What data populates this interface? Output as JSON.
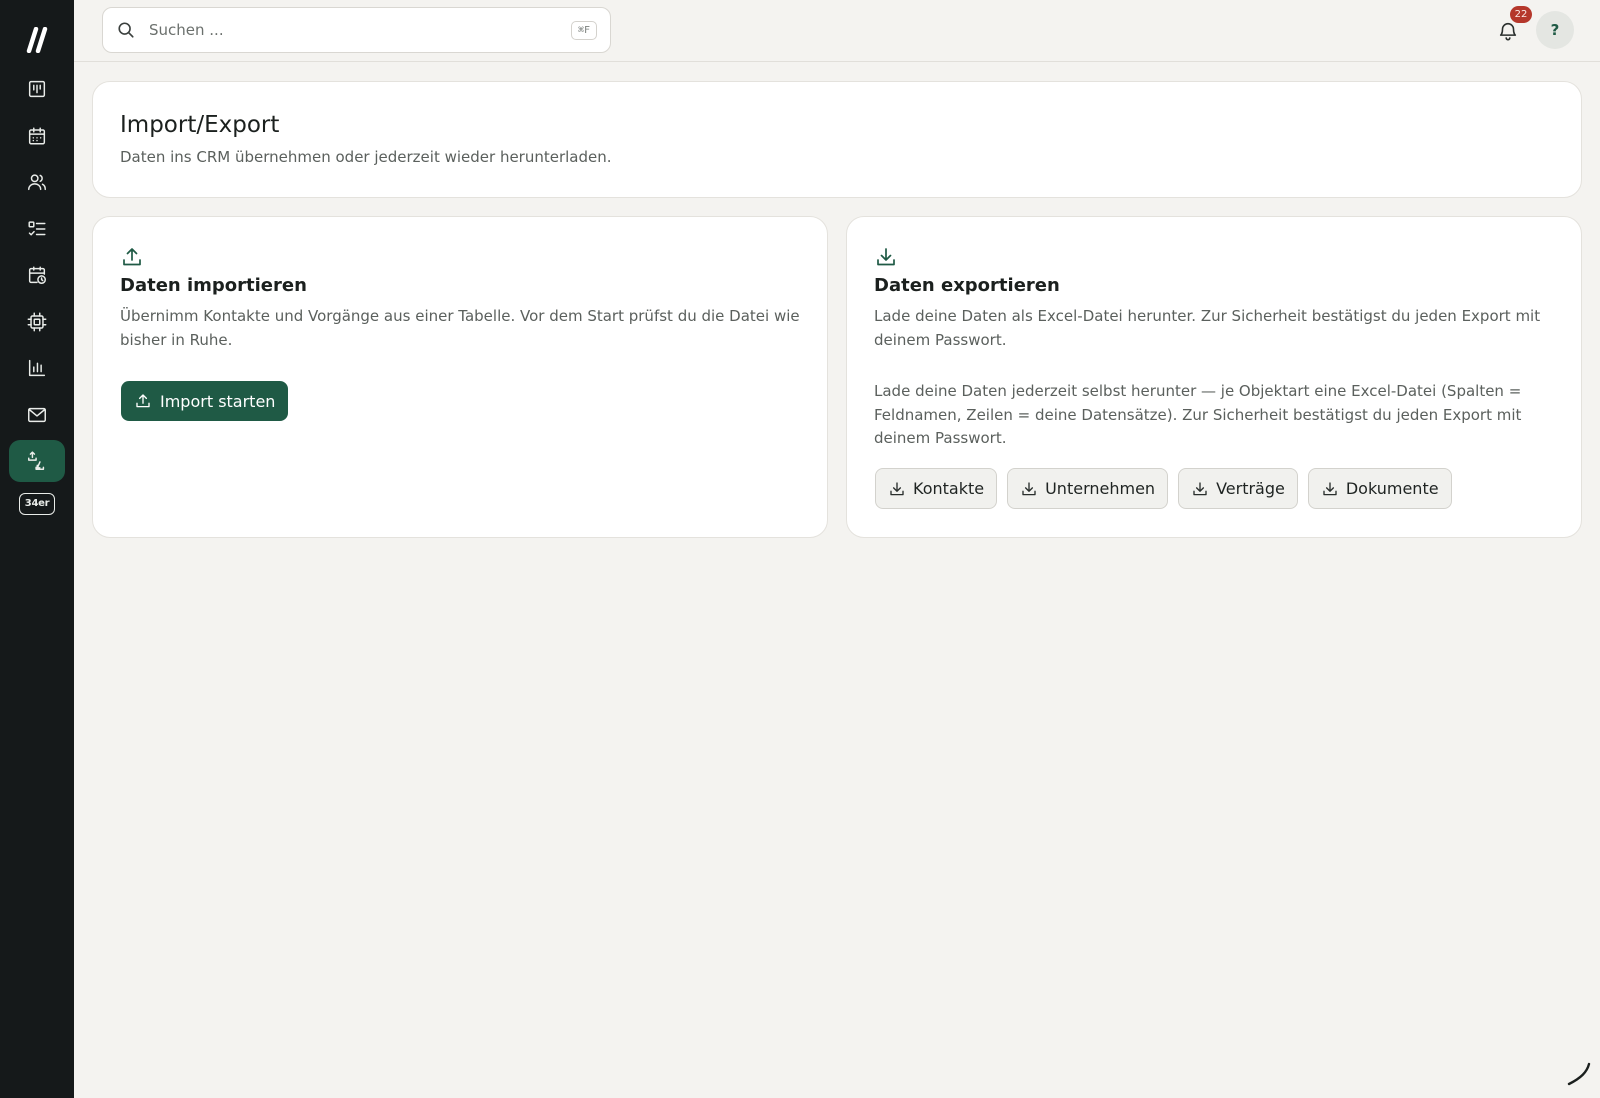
{
  "sidebar": {
    "logo": "slashes-logo",
    "items": [
      {
        "icon": "board-icon",
        "label": ""
      },
      {
        "icon": "calendar-icon",
        "label": ""
      },
      {
        "icon": "users-icon",
        "label": ""
      },
      {
        "icon": "task-list-icon",
        "label": ""
      },
      {
        "icon": "calendar-clock-icon",
        "label": ""
      },
      {
        "icon": "chip-icon",
        "label": ""
      },
      {
        "icon": "bar-chart-icon",
        "label": ""
      },
      {
        "icon": "mail-icon",
        "label": ""
      },
      {
        "icon": "import-export-icon",
        "label": "",
        "active": true
      }
    ],
    "badge": "34er"
  },
  "search": {
    "placeholder": "Suchen ...",
    "shortcut": "⌘F"
  },
  "notifications": {
    "count": "22"
  },
  "help": {
    "label": "?"
  },
  "header": {
    "title": "Import/Export",
    "subtitle": "Daten ins CRM übernehmen oder jederzeit wieder herunterladen."
  },
  "import_card": {
    "title": "Daten importieren",
    "description": "Übernimm Kontakte und Vorgänge aus einer Tabelle. Vor dem Start prüfst du die Datei wie bisher in Ruhe.",
    "button_label": "Import starten"
  },
  "export_card": {
    "title": "Daten exportieren",
    "description": "Lade deine Daten als Excel-Datei herunter. Zur Sicherheit bestätigst du jeden Export mit deinem Passwort.",
    "description2": "Lade deine Daten jederzeit selbst herunter — je Objektart eine Excel-Datei (Spalten = Feldnamen, Zeilen = deine Datensätze). Zur Sicherheit bestätigst du jeden Export mit deinem Passwort.",
    "buttons": [
      "Kontakte",
      "Unternehmen",
      "Verträge",
      "Dokumente"
    ]
  },
  "colors": {
    "accent": "#1f5a45",
    "sidebar": "#15191a",
    "background": "#f4f3f0",
    "badge": "#b5372b"
  }
}
